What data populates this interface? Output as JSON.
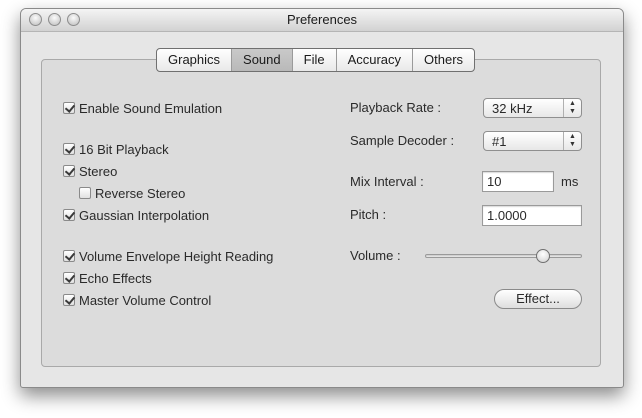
{
  "window": {
    "title": "Preferences"
  },
  "tabs": [
    "Graphics",
    "Sound",
    "File",
    "Accuracy",
    "Others"
  ],
  "active_tab": "Sound",
  "checkboxes": {
    "enable_sound_emulation": {
      "label": "Enable Sound Emulation",
      "checked": true
    },
    "bit16_playback": {
      "label": "16 Bit Playback",
      "checked": true
    },
    "stereo": {
      "label": "Stereo",
      "checked": true
    },
    "reverse_stereo": {
      "label": "Reverse Stereo",
      "checked": false
    },
    "gaussian_interpolation": {
      "label": "Gaussian Interpolation",
      "checked": true
    },
    "volume_envelope": {
      "label": "Volume Envelope Height Reading",
      "checked": true
    },
    "echo_effects": {
      "label": "Echo Effects",
      "checked": true
    },
    "master_volume": {
      "label": "Master Volume Control",
      "checked": true
    }
  },
  "right": {
    "playback_rate": {
      "label": "Playback Rate :",
      "value": "32 kHz"
    },
    "sample_decoder": {
      "label": "Sample Decoder :",
      "value": "#1"
    },
    "mix_interval": {
      "label": "Mix Interval :",
      "value": "10",
      "unit": "ms"
    },
    "pitch": {
      "label": "Pitch :",
      "value": "1.0000"
    },
    "volume": {
      "label": "Volume :",
      "level": 0.75
    },
    "effect_button": "Effect..."
  }
}
